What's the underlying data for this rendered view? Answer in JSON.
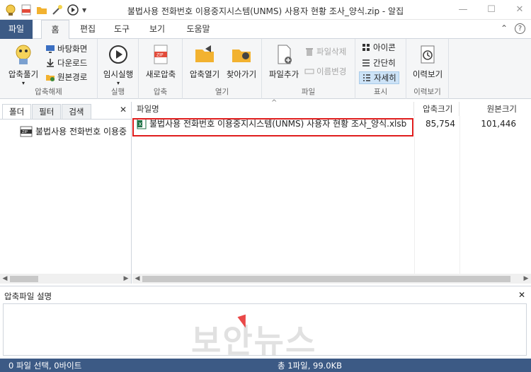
{
  "window": {
    "title": "불법사용 전화번호 이용중지시스템(UNMS) 사용자 현황 조사_양식.zip - 알집",
    "minimize": "—",
    "maximize": "☐",
    "close": "✕"
  },
  "quick_access": [
    "app-logo-icon",
    "zip-icon",
    "folder-icon",
    "wizard-icon",
    "play-icon",
    "dropdown-arrow-icon"
  ],
  "tabs": [
    {
      "label": "파일"
    },
    {
      "label": "홈"
    },
    {
      "label": "편집"
    },
    {
      "label": "도구"
    },
    {
      "label": "보기"
    },
    {
      "label": "도움말"
    }
  ],
  "tabbar_right": {
    "collapse": "⌃",
    "help": "?"
  },
  "ribbon": {
    "groups": [
      {
        "label": "압축해제",
        "big": "압축풀기",
        "small": [
          "바탕화면",
          "다운로드",
          "원본경로"
        ]
      },
      {
        "label": "실행",
        "big": "임시실행"
      },
      {
        "label": "압축",
        "big": "새로압축"
      },
      {
        "label": "열기",
        "big1": "압축열기",
        "big2": "찾아가기"
      },
      {
        "label": "파일",
        "big": "파일추가",
        "small": [
          "파일삭제",
          "이름변경"
        ]
      },
      {
        "label": "표시",
        "small": [
          "아이콘",
          "간단히",
          "자세히"
        ]
      },
      {
        "label": "이력보기",
        "big": "이력보기"
      }
    ]
  },
  "left_pane": {
    "tabs": [
      "폴더",
      "필터",
      "검색"
    ],
    "close": "✕",
    "tree_item": "불법사용 전화번호 이용중"
  },
  "file_list": {
    "columns": [
      "파일명",
      "압축크기",
      "원본크기"
    ],
    "sort_indicator": "^",
    "rows": [
      {
        "name": "불법사용 전화번호 이용중지시스템(UNMS) 사용자 현황 조사_양식.xlsb",
        "packed": "85,754",
        "original": "101,446"
      }
    ]
  },
  "description": {
    "title": "압축파일 설명",
    "close": "✕"
  },
  "watermark": "보안뉴스",
  "status": {
    "left": "0 파일 선택,  0바이트",
    "middle": "총 1파일,  99.0KB"
  },
  "colors": {
    "accent": "#3c5a85",
    "highlight": "#e01e1e",
    "ribbon_bg": "#f5f6f7"
  }
}
